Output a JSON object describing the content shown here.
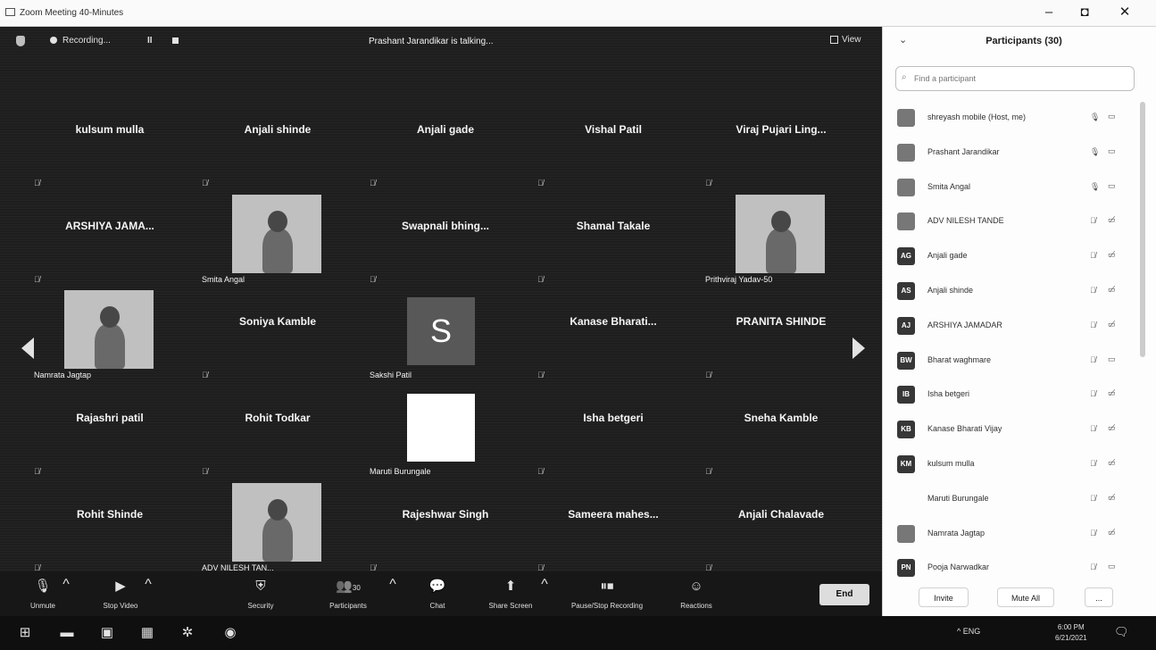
{
  "window": {
    "title": "Zoom Meeting 40-Minutes",
    "minimize": "–",
    "maximize": "◘",
    "close": "✕"
  },
  "topbar": {
    "recording": "Recording...",
    "pause": "II",
    "talking": "Prashant Jarandikar is talking...",
    "view": "View"
  },
  "tiles": [
    {
      "name": "kulsum mulla",
      "type": "name"
    },
    {
      "name": "Anjali shinde",
      "type": "name"
    },
    {
      "name": "Anjali gade",
      "type": "name"
    },
    {
      "name": "Vishal Patil",
      "type": "name"
    },
    {
      "name": "Viraj Pujari Ling...",
      "type": "name"
    },
    {
      "name": "ARSHIYA JAMA...",
      "type": "name"
    },
    {
      "name": "Smita Angal",
      "type": "video"
    },
    {
      "name": "Swapnali bhing...",
      "type": "name"
    },
    {
      "name": "Shamal Takale",
      "type": "name"
    },
    {
      "name": "Prithviraj Yadav-50",
      "type": "video"
    },
    {
      "name": "Namrata Jagtap",
      "type": "video"
    },
    {
      "name": "Soniya Kamble",
      "type": "name"
    },
    {
      "name": "Sakshi Patil",
      "type": "letter",
      "letter": "S"
    },
    {
      "name": "Kanase Bharati...",
      "type": "name"
    },
    {
      "name": "PRANITA SHINDE",
      "type": "name"
    },
    {
      "name": "Rajashri patil",
      "type": "name"
    },
    {
      "name": "Rohit Todkar",
      "type": "name"
    },
    {
      "name": "Maruti Burungale",
      "type": "blank"
    },
    {
      "name": "Isha betgeri",
      "type": "name"
    },
    {
      "name": "Sneha Kamble",
      "type": "name"
    },
    {
      "name": "Rohit Shinde",
      "type": "name"
    },
    {
      "name": "ADV NILESH TAN...",
      "type": "video"
    },
    {
      "name": "Rajeshwar Singh",
      "type": "name"
    },
    {
      "name": "Sameera mahes...",
      "type": "name"
    },
    {
      "name": "Anjali Chalavade",
      "type": "name"
    }
  ],
  "toolbar": {
    "unmute": "Unmute",
    "stop_video": "Stop Video",
    "security": "Security",
    "participants": "Participants",
    "participants_count": "30",
    "chat": "Chat",
    "share_screen": "Share Screen",
    "pause_stop_recording": "Pause/Stop Recording",
    "reactions": "Reactions",
    "end": "End"
  },
  "panel": {
    "title": "Participants (30)",
    "search_placeholder": "Find a participant",
    "participants": [
      {
        "name": "shreyash mobile (Host, me)",
        "avatar": "",
        "photo": true,
        "mic": "on",
        "cam": "on"
      },
      {
        "name": "Prashant Jarandikar",
        "avatar": "",
        "photo": true,
        "mic": "on",
        "cam": "on"
      },
      {
        "name": "Smita Angal",
        "avatar": "",
        "photo": true,
        "mic": "on",
        "cam": "on"
      },
      {
        "name": "ADV NILESH TANDE",
        "avatar": "",
        "photo": true,
        "mic": "off",
        "cam": "off"
      },
      {
        "name": "Anjali gade",
        "avatar": "AG",
        "photo": false,
        "mic": "off",
        "cam": "off"
      },
      {
        "name": "Anjali shinde",
        "avatar": "AS",
        "photo": false,
        "mic": "off",
        "cam": "off"
      },
      {
        "name": "ARSHIYA JAMADAR",
        "avatar": "AJ",
        "photo": false,
        "mic": "off",
        "cam": "off"
      },
      {
        "name": "Bharat waghmare",
        "avatar": "BW",
        "photo": false,
        "mic": "off",
        "cam": "on"
      },
      {
        "name": "Isha betgeri",
        "avatar": "IB",
        "photo": false,
        "mic": "off",
        "cam": "off"
      },
      {
        "name": "Kanase Bharati Vijay",
        "avatar": "KB",
        "photo": false,
        "mic": "off",
        "cam": "off"
      },
      {
        "name": "kulsum mulla",
        "avatar": "KM",
        "photo": false,
        "mic": "off",
        "cam": "off"
      },
      {
        "name": "Maruti Burungale",
        "avatar": "",
        "photo": false,
        "mic": "off",
        "cam": "off"
      },
      {
        "name": "Namrata Jagtap",
        "avatar": "",
        "photo": true,
        "mic": "off",
        "cam": "off"
      },
      {
        "name": "Pooja Narwadkar",
        "avatar": "PN",
        "photo": false,
        "mic": "off",
        "cam": "on"
      }
    ],
    "invite": "Invite",
    "mute_all": "Mute All",
    "more": "..."
  },
  "taskbar": {
    "tray": "^ ENG",
    "time": "6:00 PM",
    "date": "6/21/2021"
  }
}
